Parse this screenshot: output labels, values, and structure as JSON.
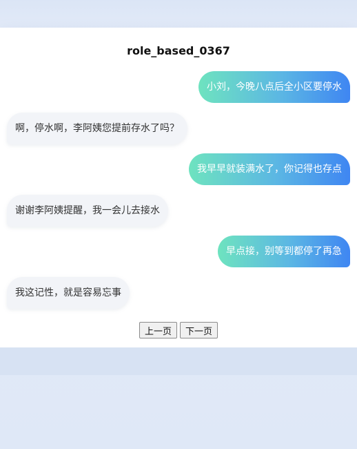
{
  "title": "role_based_0367",
  "messages": [
    {
      "side": "right",
      "text": "小刘，今晚八点后全小区要停水"
    },
    {
      "side": "left",
      "text": "啊，停水啊，李阿姨您提前存水了吗？"
    },
    {
      "side": "right",
      "text": "我早早就装满水了，你记得也存点"
    },
    {
      "side": "left",
      "text": "谢谢李阿姨提醒，我一会儿去接水"
    },
    {
      "side": "right",
      "text": "早点接，别等到都停了再急"
    },
    {
      "side": "left",
      "text": "我这记性，就是容易忘事"
    }
  ],
  "pager": {
    "prev_label": "上一页",
    "next_label": "下一页"
  },
  "colors": {
    "outgoing_gradient_start": "#6ee3bf",
    "outgoing_gradient_end": "#3f86f2",
    "incoming_bg": "#f2f4f8"
  }
}
